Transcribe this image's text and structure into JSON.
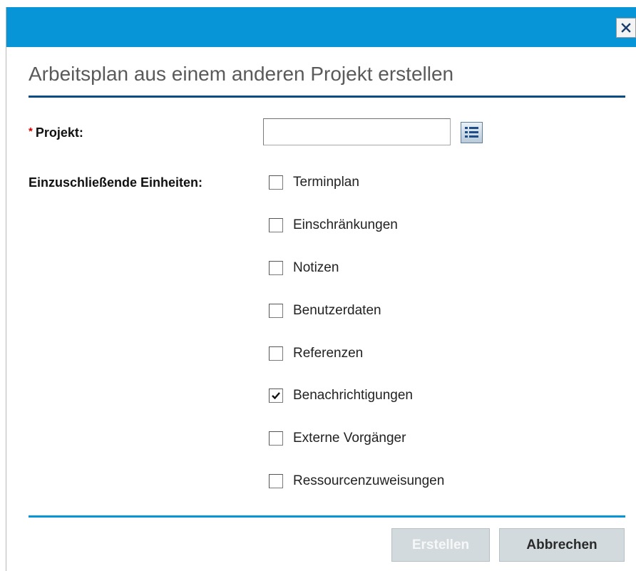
{
  "dialog": {
    "title": "Arbeitsplan aus einem anderen Projekt erstellen",
    "close_label": "×",
    "accent_color": "#0795d7",
    "heading_rule_color": "#0a4c86"
  },
  "form": {
    "project": {
      "required_marker": "*",
      "label": "Projekt:",
      "value": "",
      "lookup_icon": "list-icon"
    },
    "units": {
      "label": "Einzuschließende Einheiten:",
      "options": [
        {
          "label": "Terminplan",
          "checked": false
        },
        {
          "label": "Einschränkungen",
          "checked": false
        },
        {
          "label": "Notizen",
          "checked": false
        },
        {
          "label": "Benutzerdaten",
          "checked": false
        },
        {
          "label": "Referenzen",
          "checked": false
        },
        {
          "label": "Benachrichtigungen",
          "checked": true
        },
        {
          "label": "Externe Vorgänger",
          "checked": false
        },
        {
          "label": "Ressourcenzuweisungen",
          "checked": false
        }
      ]
    }
  },
  "footer": {
    "create_label": "Erstellen",
    "create_enabled": false,
    "cancel_label": "Abbrechen"
  }
}
